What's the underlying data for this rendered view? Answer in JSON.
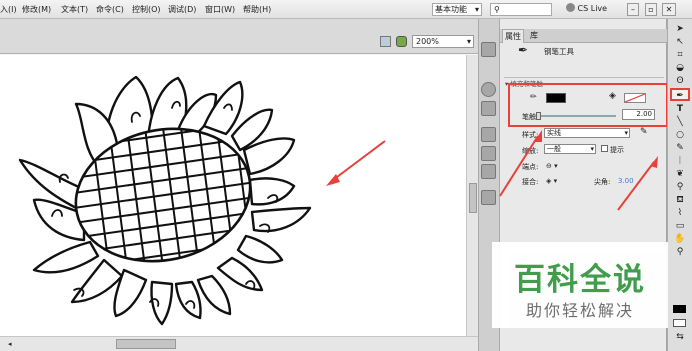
{
  "menubar": {
    "items": [
      "入(I)",
      "修改(M)",
      "文本(T)",
      "命令(C)",
      "控制(O)",
      "调试(D)",
      "窗口(W)",
      "帮助(H)"
    ],
    "workspace": "基本功能",
    "search_placeholder": "",
    "cs_live": "CS Live"
  },
  "stage": {
    "zoom": "200%"
  },
  "panel": {
    "tabs": [
      "属性",
      "库"
    ],
    "tool_name": "钢笔工具",
    "section_title": "填充和笔触",
    "stroke_label": "笔触:",
    "stroke_value": "2.00",
    "style_label": "样式:",
    "style_value": "实线",
    "scale_label": "缩放:",
    "scale_value": "一般",
    "hint_label": "提示",
    "cap_label": "端点:",
    "join_label": "接合:",
    "miter_label": "尖角:",
    "miter_value": "3.00"
  },
  "watermark": {
    "title": "百科全说",
    "subtitle": "助你轻松解决"
  },
  "colors": {
    "stroke_color": "#000000",
    "fill_color": "none",
    "highlight": "#e8403a",
    "watermark_green": "#3c9b46"
  }
}
